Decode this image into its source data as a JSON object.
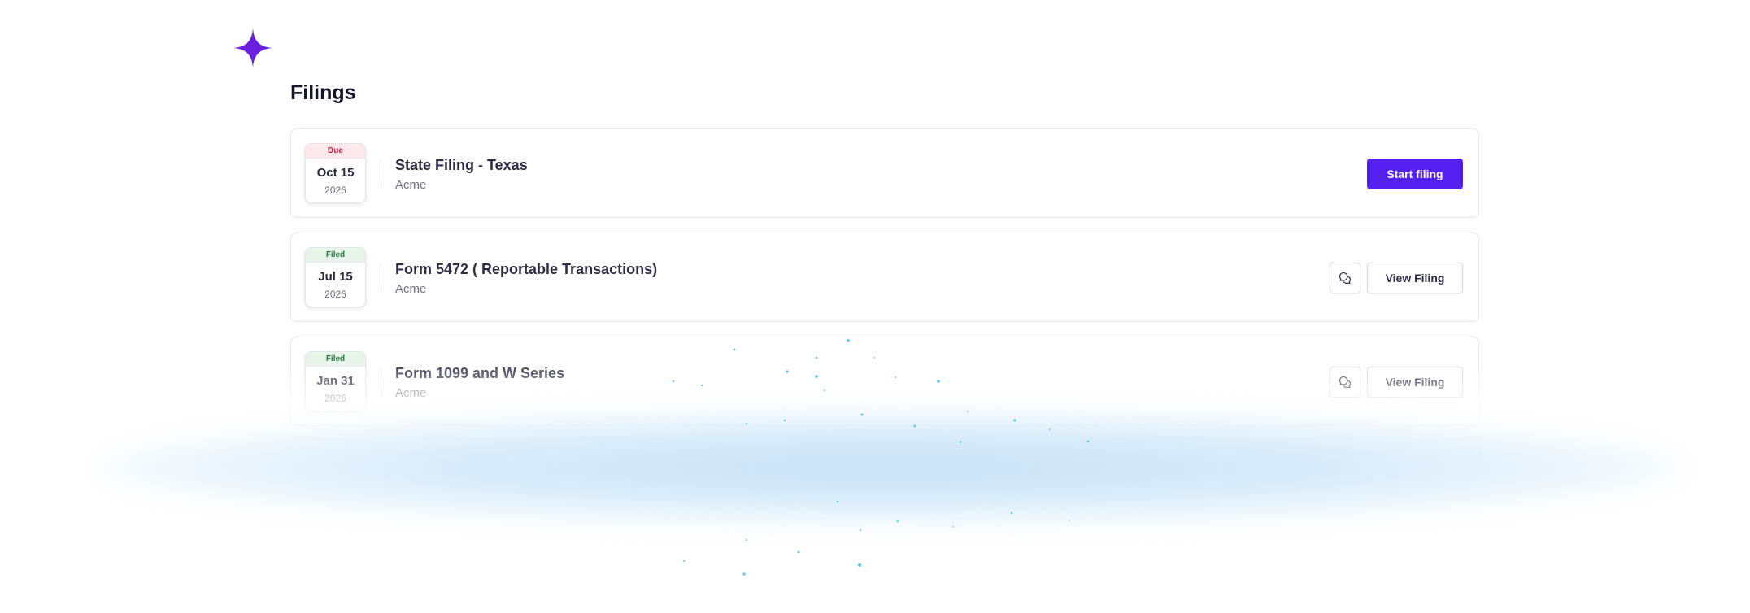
{
  "page": {
    "title": "Filings"
  },
  "filings": [
    {
      "status": "Due",
      "date": "Oct 15",
      "year": "2026",
      "title": "State Filing - Texas",
      "company": "Acme",
      "action_label": "Start filing"
    },
    {
      "status": "Filed",
      "date": "Jul 15",
      "year": "2026",
      "title": "Form 5472 ( Reportable Transactions)",
      "company": "Acme",
      "action_label": "View Filing",
      "comment_icon": "chat-bubbles-icon"
    },
    {
      "status": "Filed",
      "date": "Jan 31",
      "year": "2026",
      "title": "Form 1099 and W Series",
      "company": "Acme",
      "action_label": "View Filing",
      "comment_icon": "chat-bubbles-icon"
    }
  ],
  "icons": {
    "logo": "sparkle-star-icon",
    "comment": "chat-bubbles-icon"
  },
  "colors": {
    "accent": "#5521f0",
    "logo": "#6a1fe0",
    "due_bg": "#fde8ec",
    "due_text": "#c0183c",
    "filed_bg": "#e6f4ea",
    "filed_text": "#237a3c",
    "glow": "#96c8f0"
  }
}
